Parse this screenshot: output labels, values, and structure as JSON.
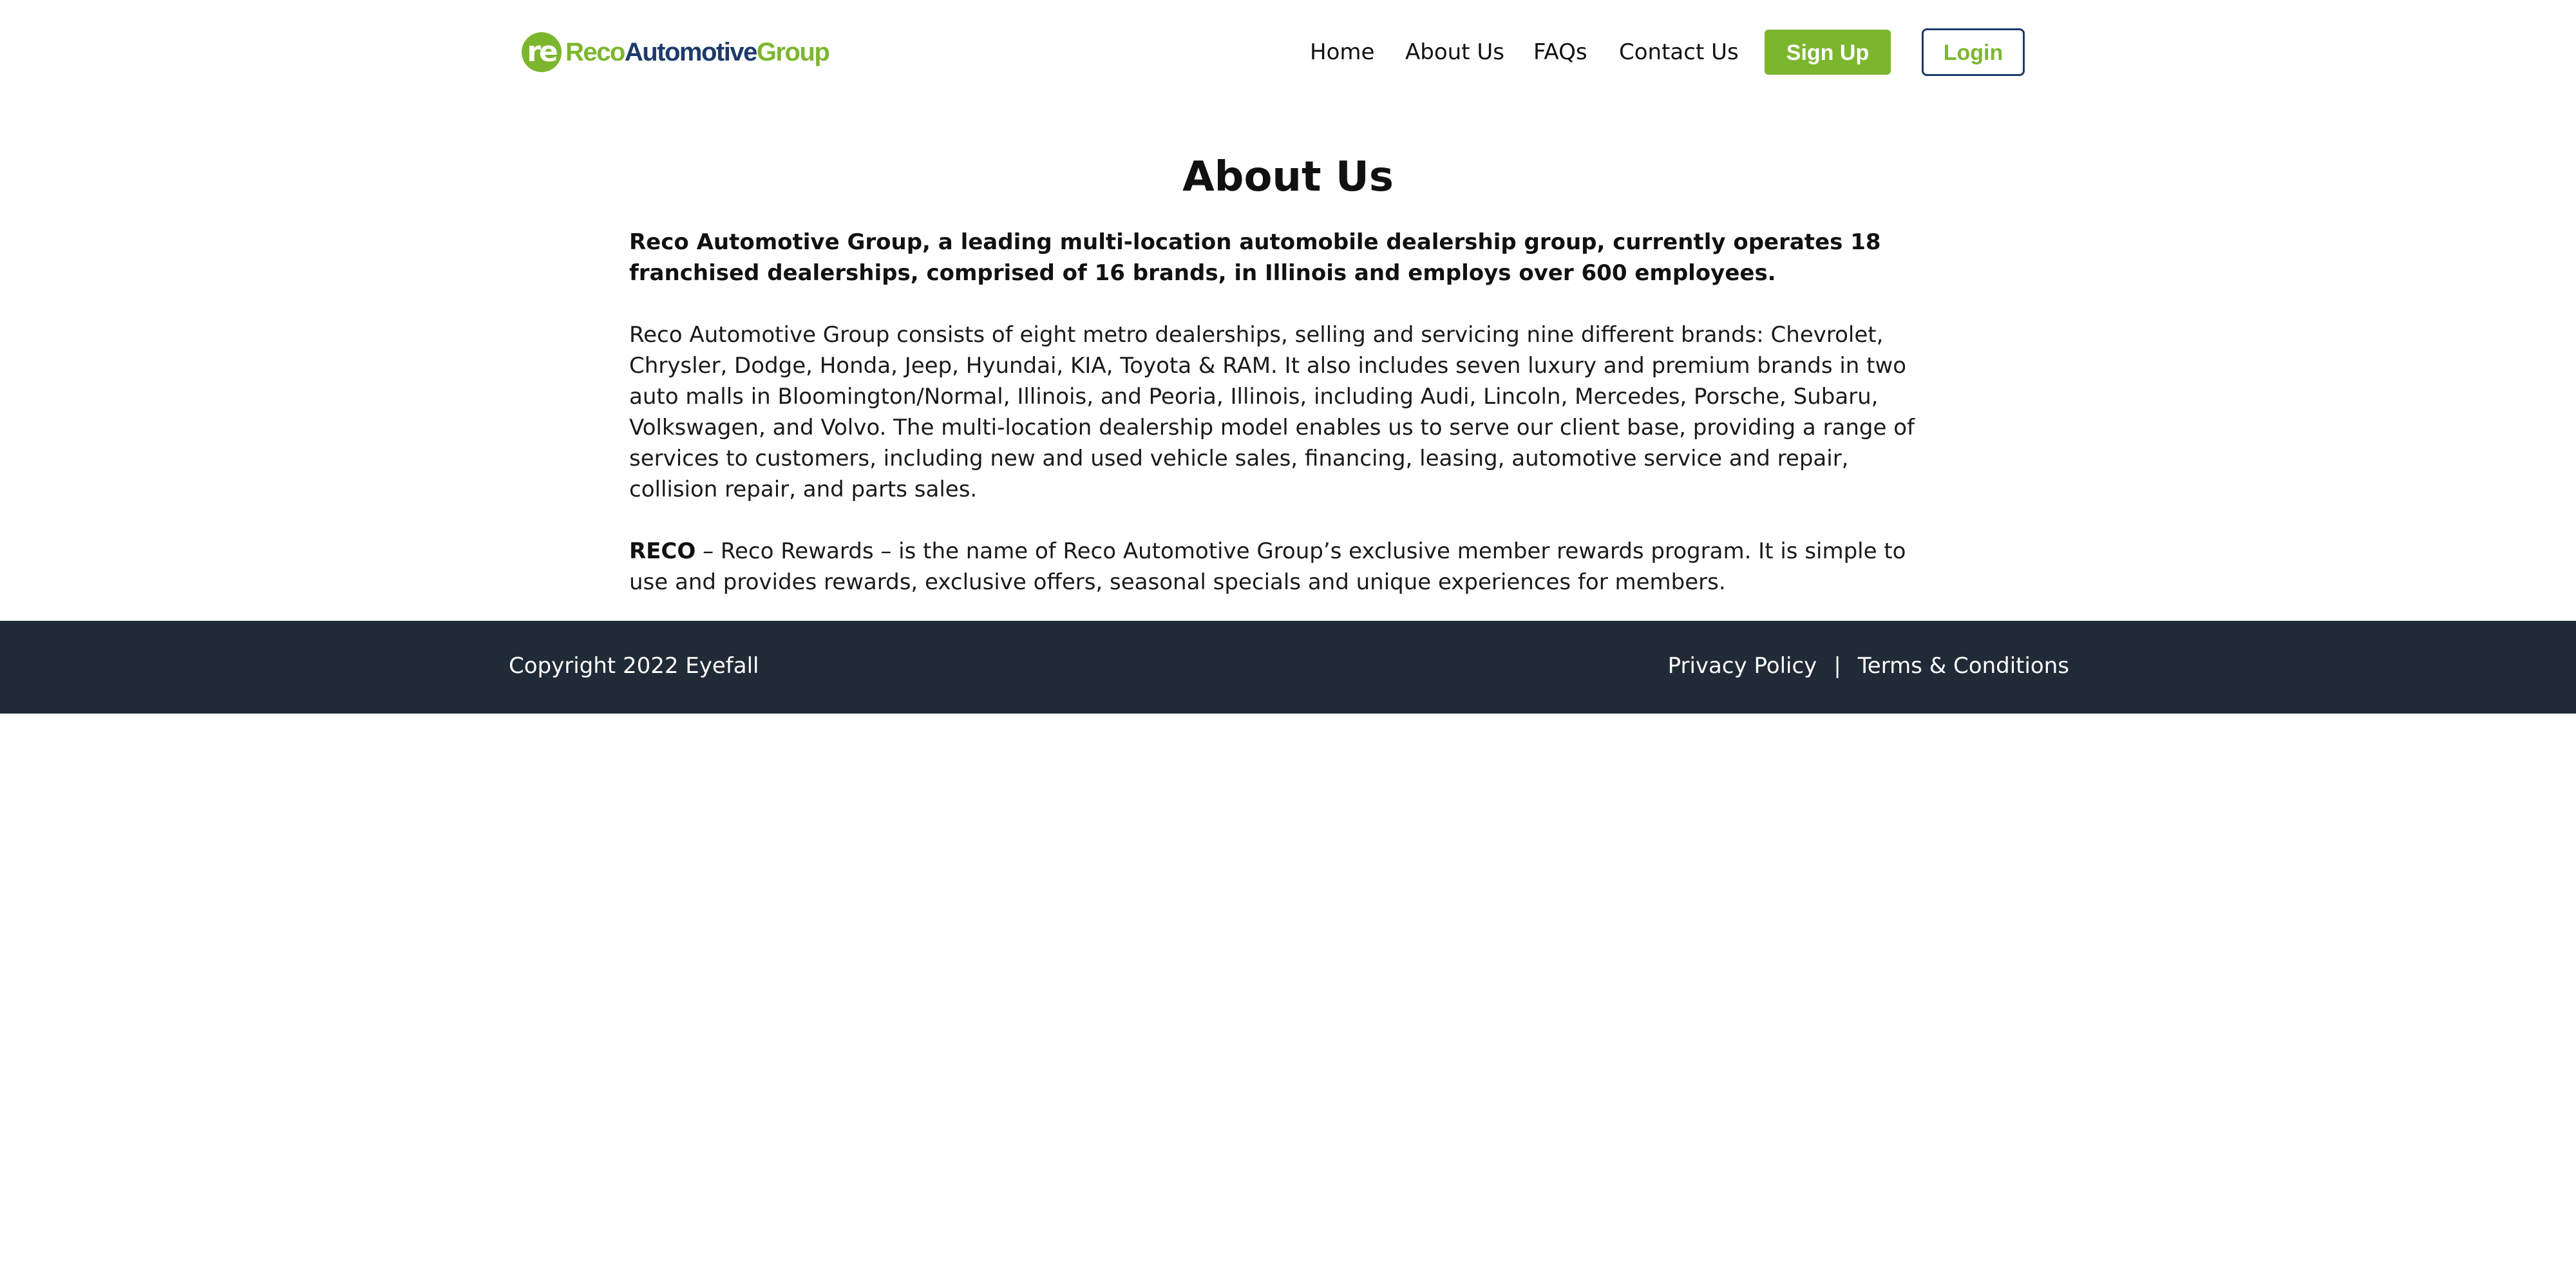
{
  "header": {
    "logo": {
      "badge_text": "re",
      "word_part1": "Reco",
      "word_part2": "Automotive",
      "word_part3": "Group"
    },
    "nav": [
      {
        "label": "Home"
      },
      {
        "label": "About Us"
      },
      {
        "label": "FAQs"
      },
      {
        "label": "Contact Us"
      }
    ],
    "signup_label": "Sign Up",
    "login_label": "Login"
  },
  "main": {
    "title": "About Us",
    "lead": "Reco Automotive Group, a leading multi-location automobile dealership group, currently operates 18 franchised dealerships, comprised of 16 brands, in Illinois and employs over 600 employees.",
    "body": "Reco Automotive Group consists of eight metro dealerships, selling and servicing nine different brands: Chevrolet, Chrysler, Dodge, Honda, Jeep, Hyundai, KIA, Toyota & RAM. It also includes seven luxury and premium brands in two auto malls in Bloomington/Normal, Illinois, and Peoria, Illinois, including Audi, Lincoln, Mercedes, Porsche, Subaru, Volkswagen, and Volvo. The multi-location dealership model enables us to serve our client base, providing a range of services to customers, including new and used vehicle sales, financing, leasing, automotive service and repair, collision repair, and parts sales.",
    "rewards_strong": "RECO",
    "rewards_text": " – Reco Rewards – is the name of Reco Automotive Group’s exclusive member rewards program. It is simple to use and provides rewards, exclusive offers, seasonal specials and unique experiences for members."
  },
  "footer": {
    "copyright": "Copyright 2022 Eyefall",
    "privacy_label": "Privacy Policy",
    "separator": "|",
    "terms_label": "Terms & Conditions"
  },
  "colors": {
    "brand_green": "#7cb62e",
    "brand_navy": "#1c3a6b",
    "footer_bg": "#212a37"
  }
}
